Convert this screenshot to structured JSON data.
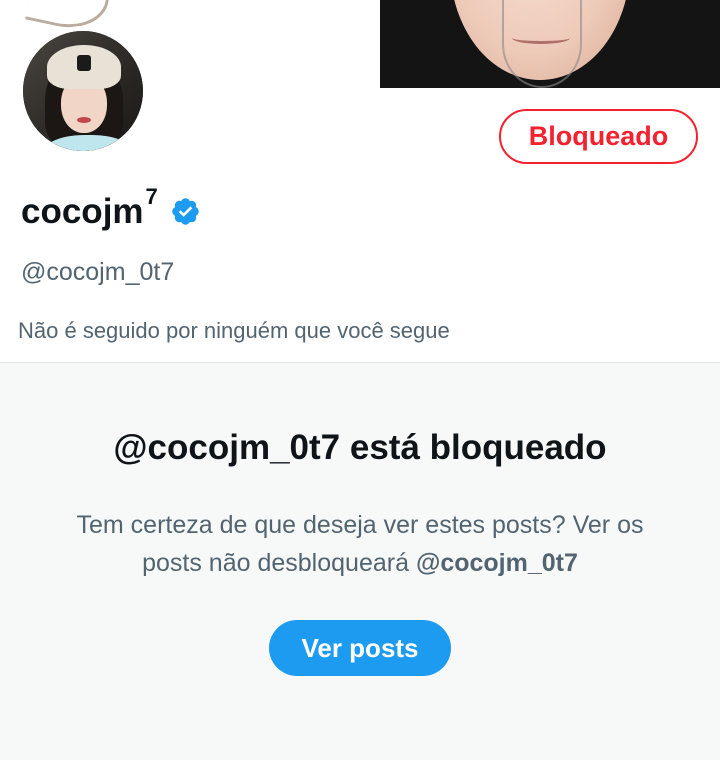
{
  "profile": {
    "display_name": "cocojm",
    "display_name_sup": "7",
    "handle": "@cocojm_0t7",
    "follow_info": "Não é seguido por ninguém que você segue"
  },
  "actions": {
    "blocked_label": "Bloqueado"
  },
  "blocked_notice": {
    "title": "@cocojm_0t7 está bloqueado",
    "description": "Tem certeza de que deseja ver estes posts? Ver os posts não desbloqueará",
    "description_handle": "@cocojm_0t7",
    "view_posts_label": "Ver posts"
  },
  "colors": {
    "accent": "#1d9bf0",
    "blocked": "#f4212e",
    "secondary_text": "#536471"
  },
  "icons": {
    "verified": "verified-badge-icon"
  }
}
